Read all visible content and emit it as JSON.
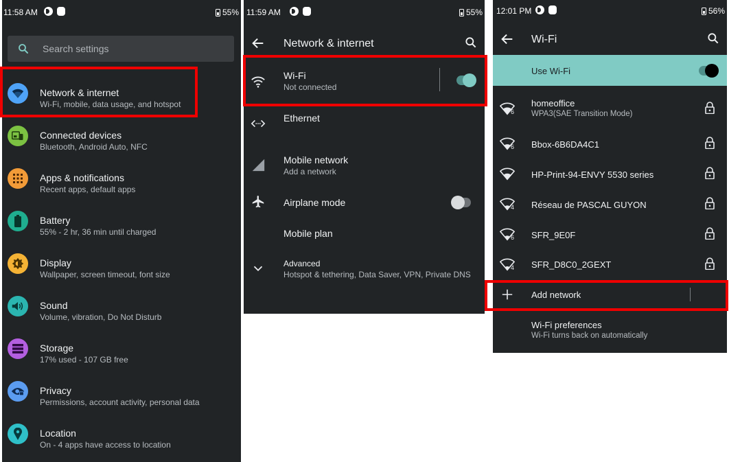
{
  "colors": {
    "panel_bg": "#212426",
    "accent": "#80cbc4",
    "highlight": "#ee0000"
  },
  "panel1": {
    "status": {
      "time": "11:58 AM",
      "battery": "55%"
    },
    "search": {
      "placeholder": "Search settings",
      "icon": "search-icon"
    },
    "items": [
      {
        "title": "Network & internet",
        "subtitle": "Wi-Fi, mobile, data usage, and hotspot",
        "icon": "wifi-icon",
        "color": "#4fa3f7"
      },
      {
        "title": "Connected devices",
        "subtitle": "Bluetooth, Android Auto, NFC",
        "icon": "devices-icon",
        "color": "#7cc242"
      },
      {
        "title": "Apps & notifications",
        "subtitle": "Recent apps, default apps",
        "icon": "apps-grid-icon",
        "color": "#f29b38"
      },
      {
        "title": "Battery",
        "subtitle": "55% - 2 hr, 36 min until charged",
        "icon": "battery-icon",
        "color": "#1fae8f"
      },
      {
        "title": "Display",
        "subtitle": "Wallpaper, screen timeout, font size",
        "icon": "brightness-icon",
        "color": "#f5b335"
      },
      {
        "title": "Sound",
        "subtitle": "Volume, vibration, Do Not Disturb",
        "icon": "volume-icon",
        "color": "#2bb5b0"
      },
      {
        "title": "Storage",
        "subtitle": "17% used - 107 GB free",
        "icon": "storage-icon",
        "color": "#b45fe0"
      },
      {
        "title": "Privacy",
        "subtitle": "Permissions, account activity, personal data",
        "icon": "privacy-eye-icon",
        "color": "#5b9cf0"
      },
      {
        "title": "Location",
        "subtitle": "On - 4 apps have access to location",
        "icon": "location-pin-icon",
        "color": "#2fc0c8"
      }
    ]
  },
  "panel2": {
    "status": {
      "time": "11:59 AM",
      "battery": "55%"
    },
    "title": "Network & internet",
    "wifi": {
      "title": "Wi-Fi",
      "subtitle": "Not connected"
    },
    "ethernet": {
      "title": "Ethernet"
    },
    "mobile_network": {
      "title": "Mobile network",
      "subtitle": "Add a network"
    },
    "airplane": {
      "title": "Airplane mode"
    },
    "mobile_plan": {
      "title": "Mobile plan"
    },
    "advanced": {
      "title": "Advanced",
      "subtitle": "Hotspot & tethering, Data Saver, VPN, Private DNS"
    }
  },
  "panel3": {
    "status": {
      "time": "12:01 PM",
      "battery": "56%"
    },
    "title": "Wi-Fi",
    "use_wifi": "Use Wi-Fi",
    "networks": [
      {
        "name": "homeoffice",
        "detail": "WPA3(SAE Transition Mode)",
        "badge": "6"
      },
      {
        "name": "Bbox-6B6DA4C1",
        "detail": "",
        "badge": "6"
      },
      {
        "name": "HP-Print-94-ENVY 5530 series",
        "detail": "",
        "badge": ""
      },
      {
        "name": "Réseau de PASCAL GUYON",
        "detail": "",
        "badge": "4"
      },
      {
        "name": "SFR_9E0F",
        "detail": "",
        "badge": "6"
      },
      {
        "name": "SFR_D8C0_2GEXT",
        "detail": "",
        "badge": "4"
      }
    ],
    "add_network": "Add network",
    "preferences": {
      "title": "Wi-Fi preferences",
      "subtitle": "Wi-Fi turns back on automatically"
    }
  }
}
